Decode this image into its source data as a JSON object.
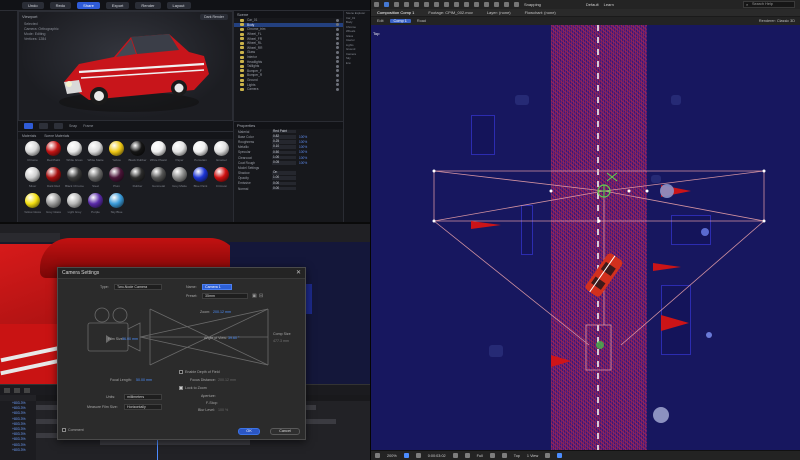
{
  "tl_app": {
    "toolbar_buttons": [
      "Undo",
      "Redo",
      "Share",
      "Export",
      "Render",
      "Layout"
    ],
    "viewport_title": "Viewport",
    "viewport_button": "Dark Render",
    "viewport_info": [
      "Selected",
      "Camera: Orthographic",
      "Mode: Editing",
      "Vertices: 1284"
    ],
    "viewport_tools": [
      "Move",
      "Rotate",
      "Scale",
      "Snap",
      "Frame"
    ],
    "mat_tabs": [
      "Materials",
      "Scene Materials"
    ],
    "materials": [
      {
        "label": "Chrome",
        "color": "#d8d8d8"
      },
      {
        "label": "Red Paint",
        "color": "#c41414"
      },
      {
        "label": "White Gloss",
        "color": "#e8e8e8"
      },
      {
        "label": "White Matte",
        "color": "#dcdcdc"
      },
      {
        "label": "Yellow",
        "color": "#f0c814"
      },
      {
        "label": "Black Rubber",
        "color": "#151515"
      },
      {
        "label": "White Plastic",
        "color": "#efefef"
      },
      {
        "label": "Paper",
        "color": "#e4e4e4"
      },
      {
        "label": "Porcelain",
        "color": "#f0f0f0"
      },
      {
        "label": "Enamel",
        "color": "#e0e0e0"
      },
      {
        "label": "Silver",
        "color": "#cfcfcf"
      },
      {
        "label": "Dark Red",
        "color": "#a50e0e"
      },
      {
        "label": "Black Chrome",
        "color": "#3a3a3a"
      },
      {
        "label": "Steel",
        "color": "#6a6a6a"
      },
      {
        "label": "Plum",
        "color": "#4a1438"
      },
      {
        "label": "Rubber",
        "color": "#2b2b2b"
      },
      {
        "label": "Gunmetal",
        "color": "#555555"
      },
      {
        "label": "Grey Matte",
        "color": "#8a8a8a"
      },
      {
        "label": "Blue Paint",
        "color": "#1c34d4"
      },
      {
        "label": "Crimson",
        "color": "#d01010"
      },
      {
        "label": "Yellow Gloss",
        "color": "#f4e010"
      },
      {
        "label": "Grey Glass",
        "color": "#9a9a9a"
      },
      {
        "label": "Light Grey",
        "color": "#b8b8b8"
      },
      {
        "label": "Purple",
        "color": "#5a2aa8"
      },
      {
        "label": "Sky Blue",
        "color": "#3a9ad8"
      }
    ],
    "scene_title": "Scene",
    "scene_items": [
      {
        "label": "Car_01",
        "sel": false
      },
      {
        "label": "Body",
        "sel": true
      },
      {
        "label": "Chrome_trim",
        "sel": false
      },
      {
        "label": "Wheel_FL",
        "sel": false
      },
      {
        "label": "Wheel_FR",
        "sel": false
      },
      {
        "label": "Wheel_RL",
        "sel": false
      },
      {
        "label": "Wheel_RR",
        "sel": false
      },
      {
        "label": "Glass",
        "sel": false
      },
      {
        "label": "Interior",
        "sel": false
      },
      {
        "label": "Headlights",
        "sel": false
      },
      {
        "label": "Taillights",
        "sel": false
      },
      {
        "label": "Bumper_F",
        "sel": false
      },
      {
        "label": "Bumper_R",
        "sel": false
      },
      {
        "label": "Ground",
        "sel": false
      },
      {
        "label": "Lights",
        "sel": false
      },
      {
        "label": "Camera",
        "sel": false
      }
    ],
    "props_title": "Properties",
    "props": [
      {
        "label": "Material",
        "value": "Red Paint",
        "value2": ""
      },
      {
        "label": "Base Color",
        "value": "0.82",
        "value2": "100%"
      },
      {
        "label": "Roughness",
        "value": "0.25",
        "value2": "100%"
      },
      {
        "label": "Metallic",
        "value": "0.10",
        "value2": "100%"
      },
      {
        "label": "Specular",
        "value": "0.50",
        "value2": "100%"
      },
      {
        "label": "Clearcoat",
        "value": "1.00",
        "value2": "100%"
      },
      {
        "label": "Coat Rough",
        "value": "0.05",
        "value2": "100%"
      },
      {
        "label": "Model Settings",
        "value": "",
        "value2": ""
      },
      {
        "label": "Shadow",
        "value": "On",
        "value2": ""
      },
      {
        "label": "Opacity",
        "value": "1.00",
        "value2": ""
      },
      {
        "label": "Emissive",
        "value": "0.00",
        "value2": ""
      },
      {
        "label": "Normal",
        "value": "0.00",
        "value2": ""
      }
    ],
    "right_items": [
      "Scene Explorer",
      "Car_01",
      "Body",
      "Chrome",
      "Wheels",
      "Glass",
      "Interior",
      "Lights",
      "Ground",
      "Camera",
      "Sky",
      "Env"
    ]
  },
  "ae_small": {
    "layer_values": [
      "+803.3%",
      "+803.3%",
      "+803.3%",
      "+803.3%",
      "+803.3%",
      "+803.3%",
      "+803.3%",
      "+803.3%",
      "+803.3%",
      "+803.3%"
    ]
  },
  "dialog": {
    "title": "Camera Settings",
    "type_label": "Type:",
    "type_value": "Two-Node Camera",
    "name_label": "Name:",
    "name_value": "Camera 1",
    "preset_label": "Preset:",
    "preset_value": "35mm",
    "zoom_label": "Zoom:",
    "zoom_value": "200.12 mm",
    "fov_label": "Angle of View:",
    "fov_value": "39.60 °",
    "film_size_label": "Film Size:",
    "film_size_value": "36.00 mm",
    "comp_size_label": "Comp Size",
    "comp_size_value": "477.3 mm",
    "focal_label": "Focal Length:",
    "focal_value": "50.00 mm",
    "units_label": "Units:",
    "units_value": "millimeters",
    "measure_label": "Measure Film Size:",
    "measure_value": "Horizontally",
    "dof_label": "Enable Depth of Field",
    "focus_dist_label": "Focus Distance:",
    "focus_dist_value": "200.12 mm",
    "lock_label": "Lock to Zoom",
    "aperture_label": "Aperture:",
    "aperture_value": "25.3 mm",
    "fstop_label": "F-Stop:",
    "fstop_value": "1.4",
    "blur_label": "Blur Level:",
    "blur_value": "100 %",
    "comment_label": "Comment",
    "ok_label": "OK",
    "cancel_label": "Cancel"
  },
  "right_view": {
    "toolbar_labels": [
      "Snapping",
      "Default",
      "Learn",
      "Standard",
      "Small Screen"
    ],
    "search_placeholder": "Search Help",
    "panel_tabs": [
      "Composition Comp 1",
      "Footage: CPIM_002.mov",
      "Layer: (none)",
      "Flowchart: (none)"
    ],
    "crumbs": [
      "Edit",
      "Comp 1",
      "Road"
    ],
    "renderer": "Renderer: Classic 3D",
    "comp_label": "Top",
    "bottom": [
      "200%",
      "0:00:03:02",
      "Full",
      "Top",
      "1 View"
    ]
  }
}
